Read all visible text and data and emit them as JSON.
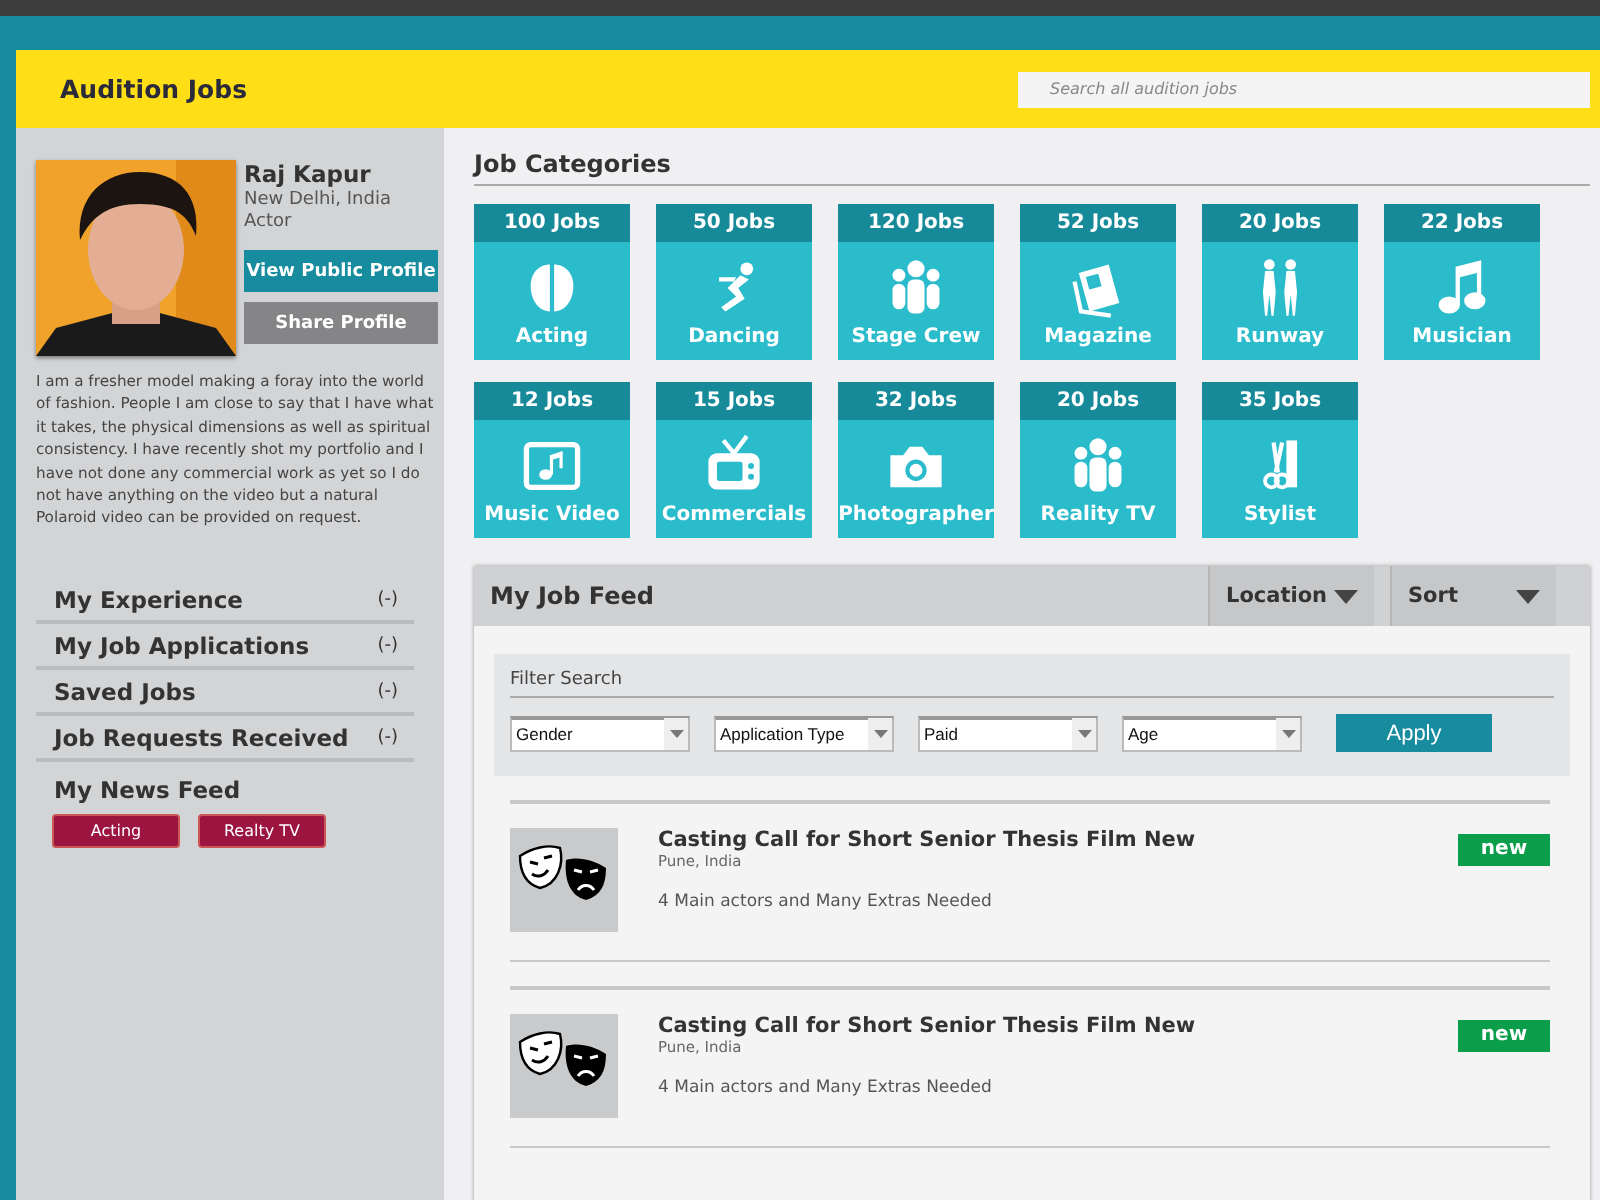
{
  "header": {
    "title": "Audition Jobs",
    "search": {
      "placeholder": "Search all audition jobs"
    }
  },
  "profile": {
    "name": "Raj Kapur",
    "location": "New Delhi, India",
    "role": "Actor",
    "buttons": [
      "View Public Profile",
      "Share Profile"
    ],
    "bio": "I am a fresher model making a foray into the world of fashion. People I am close to say that I have what it takes, the physical dimensions as well as spiritual consistency.  I have recently shot my portfolio and I have not done any commercial work as yet so I do not have anything on the video but a natural Polaroid video can be provided on request."
  },
  "sidebar": {
    "items": [
      {
        "label": "My Experience",
        "count": "(-)"
      },
      {
        "label": "My Job Applications",
        "count": "(-)"
      },
      {
        "label": "Saved Jobs",
        "count": "(-)"
      },
      {
        "label": "Job Requests Received",
        "count": "(-)"
      }
    ],
    "news_feed": {
      "title": "My News Feed",
      "tags": [
        "Acting",
        "Realty TV"
      ]
    }
  },
  "categories": {
    "title": "Job Categories",
    "items": [
      {
        "count": "100 Jobs",
        "label": "Acting",
        "kind": "acting"
      },
      {
        "count": "50 Jobs",
        "label": "Dancing",
        "kind": "dancing"
      },
      {
        "count": "120 Jobs",
        "label": "Stage Crew",
        "kind": "crew"
      },
      {
        "count": "52 Jobs",
        "label": "Magazine",
        "kind": "magazine"
      },
      {
        "count": "20 Jobs",
        "label": "Runway",
        "kind": "runway"
      },
      {
        "count": "22 Jobs",
        "label": "Musician",
        "kind": "music"
      },
      {
        "count": "12 Jobs",
        "label": "Music Video",
        "kind": "musicvideo"
      },
      {
        "count": "15 Jobs",
        "label": "Commercials",
        "kind": "tv"
      },
      {
        "count": "32 Jobs",
        "label": "Photographer",
        "kind": "camera"
      },
      {
        "count": "20 Jobs",
        "label": "Reality TV",
        "kind": "crew"
      },
      {
        "count": "35 Jobs",
        "label": "Stylist",
        "kind": "stylist"
      }
    ]
  },
  "job_feed": {
    "title": "My Job Feed",
    "dropdowns": [
      "Location",
      "Sort"
    ],
    "filter": {
      "title": "Filter Search",
      "selects": [
        "Gender",
        "Application Type",
        "Paid",
        "Age"
      ],
      "button": "Apply"
    },
    "jobs": [
      {
        "title": "Casting Call for Short Senior Thesis Film New",
        "location": "Pune, India",
        "description": "4 Main actors and Many Extras Needed",
        "badge": "new"
      },
      {
        "title": "Casting Call for Short Senior Thesis Film New",
        "location": "Pune, India",
        "description": "4 Main actors and Many Extras Needed",
        "badge": "new"
      }
    ]
  }
}
